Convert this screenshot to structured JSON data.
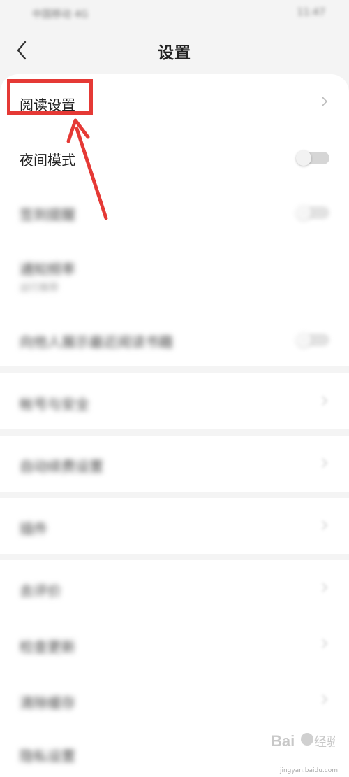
{
  "status": {
    "left": "中国移动 4G",
    "right": "11:47"
  },
  "header": {
    "title": "设置"
  },
  "items": [
    {
      "label": "阅读设置",
      "control": "chevron"
    },
    {
      "label": "夜间模式",
      "control": "toggle"
    },
    {
      "label": "签到提醒",
      "control": "toggle"
    },
    {
      "label": "通知频率",
      "sub": "运行推荐",
      "control": "none"
    },
    {
      "label": "向他人展示最近阅读书籍",
      "control": "toggle"
    },
    {
      "label": "帐号与安全",
      "control": "chevron"
    },
    {
      "label": "自动续费设置",
      "control": "chevron"
    },
    {
      "label": "插件",
      "control": "chevron"
    },
    {
      "label": "去评价",
      "control": "chevron"
    },
    {
      "label": "检查更新",
      "control": "chevron"
    },
    {
      "label": "清除缓存",
      "control": "chevron"
    },
    {
      "label": "隐私设置",
      "control": "chevron"
    }
  ],
  "watermark": {
    "brand": "Bai",
    "brand2": "经验",
    "site": "jingyan.baidu.com"
  },
  "colors": {
    "highlight": "#e53935",
    "background": "#f4f4f4",
    "card": "#ffffff"
  }
}
